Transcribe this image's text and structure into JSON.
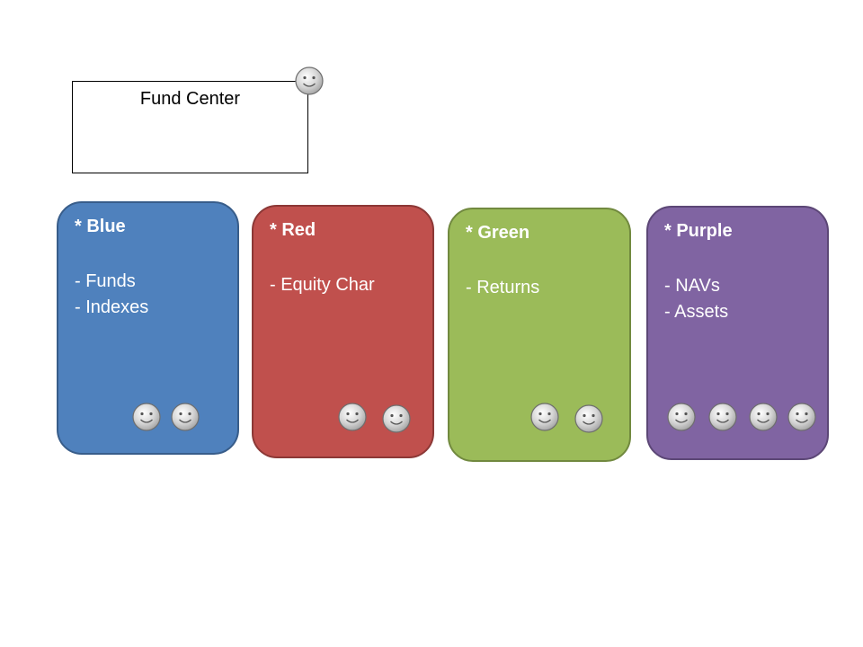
{
  "fund_center": {
    "title": "Fund Center",
    "icon": "smiley-face-icon"
  },
  "teams": [
    {
      "name": "* Blue",
      "items": [
        "- Funds",
        "- Indexes"
      ],
      "fill": "#4f81bd",
      "border": "#385d8a",
      "member_icon": "smiley-face-icon",
      "member_count": 2
    },
    {
      "name": "* Red",
      "items": [
        "- Equity Char"
      ],
      "fill": "#c0504d",
      "border": "#8c3836",
      "member_icon": "smiley-face-icon",
      "member_count": 2
    },
    {
      "name": "* Green",
      "items": [
        "- Returns"
      ],
      "fill": "#9bbb59",
      "border": "#71893f",
      "member_icon": "smiley-face-icon",
      "member_count": 2
    },
    {
      "name": "* Purple",
      "items": [
        "- NAVs",
        "- Assets"
      ],
      "fill": "#8064a2",
      "border": "#5c4776",
      "member_icon": "smiley-face-icon",
      "member_count": 4
    }
  ]
}
